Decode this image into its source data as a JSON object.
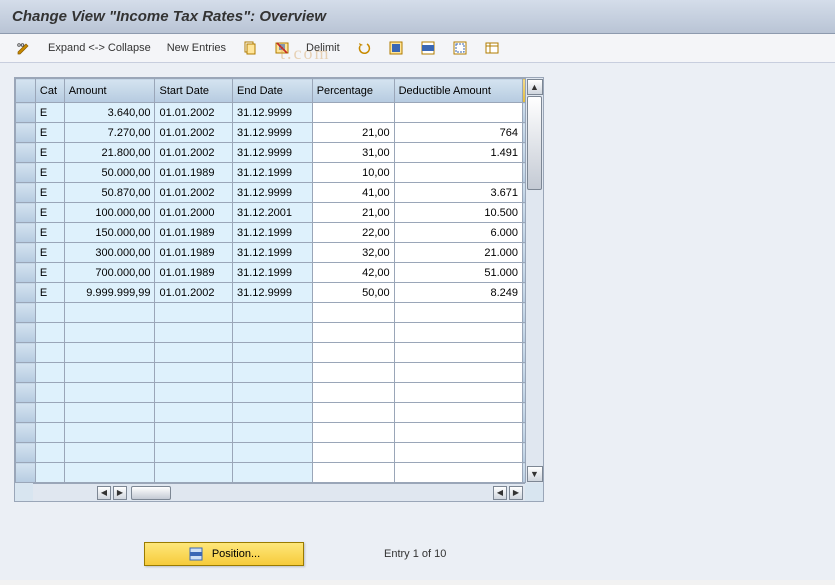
{
  "title": "Change View \"Income Tax Rates\": Overview",
  "toolbar": {
    "expand_collapse": "Expand <-> Collapse",
    "new_entries": "New Entries",
    "delimit": "Delimit"
  },
  "columns": {
    "cat": "Cat",
    "amount": "Amount",
    "start_date": "Start Date",
    "end_date": "End Date",
    "percentage": "Percentage",
    "deductible": "Deductible Amount"
  },
  "rows": [
    {
      "cat": "E",
      "amount": "3.640,00",
      "start": "01.01.2002",
      "end": "31.12.9999",
      "pct": "",
      "ded": ""
    },
    {
      "cat": "E",
      "amount": "7.270,00",
      "start": "01.01.2002",
      "end": "31.12.9999",
      "pct": "21,00",
      "ded": "764"
    },
    {
      "cat": "E",
      "amount": "21.800,00",
      "start": "01.01.2002",
      "end": "31.12.9999",
      "pct": "31,00",
      "ded": "1.491"
    },
    {
      "cat": "E",
      "amount": "50.000,00",
      "start": "01.01.1989",
      "end": "31.12.1999",
      "pct": "10,00",
      "ded": ""
    },
    {
      "cat": "E",
      "amount": "50.870,00",
      "start": "01.01.2002",
      "end": "31.12.9999",
      "pct": "41,00",
      "ded": "3.671"
    },
    {
      "cat": "E",
      "amount": "100.000,00",
      "start": "01.01.2000",
      "end": "31.12.2001",
      "pct": "21,00",
      "ded": "10.500"
    },
    {
      "cat": "E",
      "amount": "150.000,00",
      "start": "01.01.1989",
      "end": "31.12.1999",
      "pct": "22,00",
      "ded": "6.000"
    },
    {
      "cat": "E",
      "amount": "300.000,00",
      "start": "01.01.1989",
      "end": "31.12.1999",
      "pct": "32,00",
      "ded": "21.000"
    },
    {
      "cat": "E",
      "amount": "700.000,00",
      "start": "01.01.1989",
      "end": "31.12.1999",
      "pct": "42,00",
      "ded": "51.000"
    },
    {
      "cat": "E",
      "amount": "9.999.999,99",
      "start": "01.01.2002",
      "end": "31.12.9999",
      "pct": "50,00",
      "ded": "8.249"
    }
  ],
  "empty_rows": 9,
  "footer": {
    "position_btn": "Position...",
    "entry_text": "Entry 1 of 10"
  },
  "icons": {
    "pencil": "pencil-icon",
    "copy": "copy-icon",
    "save": "save-icon",
    "select_all": "select-all-icon",
    "select_block": "select-block-icon",
    "deselect": "deselect-icon",
    "deselect_all": "deselect-all-icon",
    "config": "config-columns-icon",
    "position": "position-icon"
  }
}
